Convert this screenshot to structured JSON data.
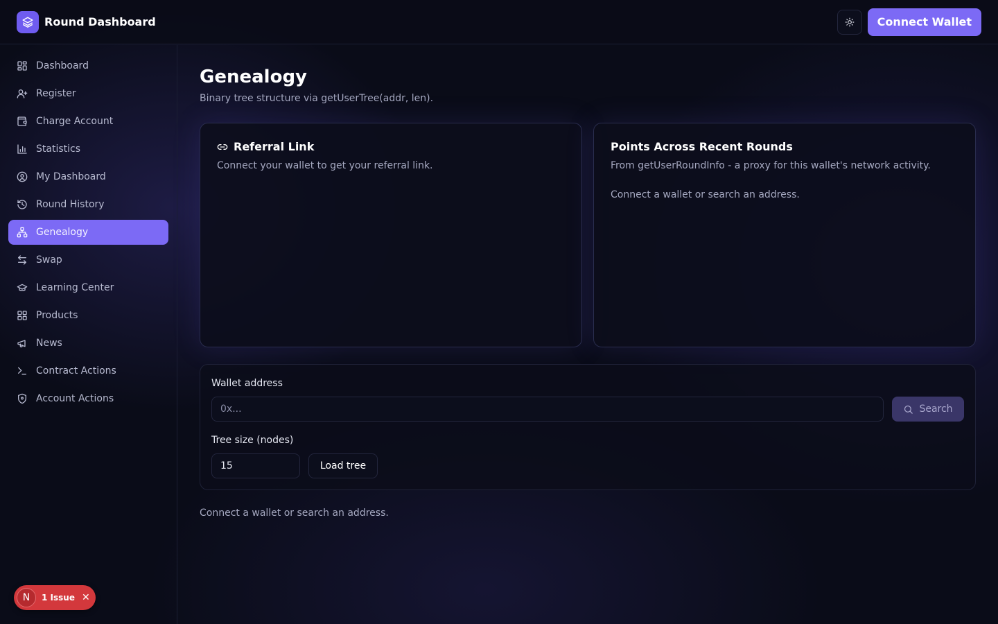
{
  "header": {
    "app_name": "Round Dashboard",
    "connect_label": "Connect Wallet",
    "logo_icon": "layers-icon",
    "theme_icon": "sun-icon"
  },
  "sidebar": {
    "items": [
      {
        "label": "Dashboard",
        "icon": "grid-icon"
      },
      {
        "label": "Register",
        "icon": "user-plus-icon"
      },
      {
        "label": "Charge Account",
        "icon": "wallet-icon"
      },
      {
        "label": "Statistics",
        "icon": "bar-chart-icon"
      },
      {
        "label": "My Dashboard",
        "icon": "user-circle-icon"
      },
      {
        "label": "Round History",
        "icon": "history-icon"
      },
      {
        "label": "Genealogy",
        "icon": "network-icon",
        "active": true
      },
      {
        "label": "Swap",
        "icon": "swap-icon"
      },
      {
        "label": "Learning Center",
        "icon": "graduation-cap-icon"
      },
      {
        "label": "Products",
        "icon": "apps-icon"
      },
      {
        "label": "News",
        "icon": "megaphone-icon"
      },
      {
        "label": "Contract Actions",
        "icon": "terminal-icon"
      },
      {
        "label": "Account Actions",
        "icon": "shield-icon"
      }
    ]
  },
  "main": {
    "title": "Genealogy",
    "subtitle": "Binary tree structure via getUserTree(addr, len).",
    "referral_card": {
      "title": "Referral Link",
      "description": "Connect your wallet to get your referral link."
    },
    "points_card": {
      "title": "Points Across Recent Rounds",
      "description": "From getUserRoundInfo - a proxy for this wallet's network activity.",
      "empty": "Connect a wallet or search an address."
    },
    "search": {
      "wallet_label": "Wallet address",
      "wallet_placeholder": "0x...",
      "search_label": "Search",
      "tree_size_label": "Tree size (nodes)",
      "tree_size_value": "15",
      "load_label": "Load tree"
    },
    "bottom_message": "Connect a wallet or search an address."
  },
  "issue_badge": {
    "letter": "N",
    "label": "1 Issue"
  },
  "colors": {
    "accent": "#7c6af5",
    "background": "#0a0c18",
    "issue": "#d3383c"
  }
}
